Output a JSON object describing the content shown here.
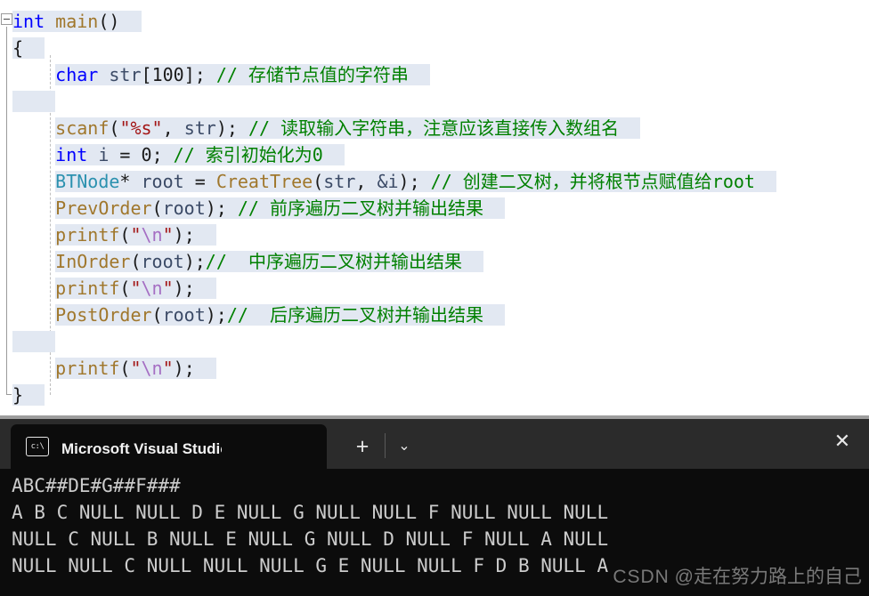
{
  "editor": {
    "collapse_state": "expanded",
    "colors": {
      "selection_bg": "#e2e8f2",
      "keyword": "#0000ff",
      "user_type": "#2b91af",
      "function": "#a0772c",
      "identifier": "#3b4a66",
      "string": "#a31515",
      "escape": "#a56ec3",
      "comment": "#008000",
      "background": "#ffffff"
    },
    "lines": [
      {
        "indent": 0,
        "tokens": [
          {
            "t": "int",
            "c": "kw"
          },
          {
            "t": " ",
            "c": "pun"
          },
          {
            "t": "main",
            "c": "fn"
          },
          {
            "t": "()",
            "c": "pun"
          }
        ]
      },
      {
        "indent": 0,
        "tokens": [
          {
            "t": "{",
            "c": "brace"
          }
        ]
      },
      {
        "indent": 1,
        "tokens": [
          {
            "t": "char",
            "c": "kw"
          },
          {
            "t": " ",
            "c": "pun"
          },
          {
            "t": "str",
            "c": "id"
          },
          {
            "t": "[",
            "c": "pun"
          },
          {
            "t": "100",
            "c": "num"
          },
          {
            "t": "]; ",
            "c": "pun"
          },
          {
            "t": "// 存储节点值的字符串",
            "c": "cm"
          }
        ]
      },
      {
        "indent": 0,
        "tokens": []
      },
      {
        "indent": 1,
        "tokens": [
          {
            "t": "scanf",
            "c": "fn"
          },
          {
            "t": "(",
            "c": "pun"
          },
          {
            "t": "\"%s\"",
            "c": "str"
          },
          {
            "t": ", ",
            "c": "pun"
          },
          {
            "t": "str",
            "c": "id"
          },
          {
            "t": "); ",
            "c": "pun"
          },
          {
            "t": "// 读取输入字符串，注意应该直接传入数组名",
            "c": "cm"
          }
        ]
      },
      {
        "indent": 1,
        "tokens": [
          {
            "t": "int",
            "c": "kw"
          },
          {
            "t": " ",
            "c": "pun"
          },
          {
            "t": "i",
            "c": "id"
          },
          {
            "t": " = ",
            "c": "pun"
          },
          {
            "t": "0",
            "c": "num"
          },
          {
            "t": "; ",
            "c": "pun"
          },
          {
            "t": "// 索引初始化为0",
            "c": "cm"
          }
        ]
      },
      {
        "indent": 1,
        "tokens": [
          {
            "t": "BTNode",
            "c": "type"
          },
          {
            "t": "* ",
            "c": "pun"
          },
          {
            "t": "root",
            "c": "id"
          },
          {
            "t": " = ",
            "c": "pun"
          },
          {
            "t": "CreatTree",
            "c": "fn"
          },
          {
            "t": "(",
            "c": "pun"
          },
          {
            "t": "str",
            "c": "id"
          },
          {
            "t": ", ",
            "c": "pun"
          },
          {
            "t": "&i",
            "c": "id"
          },
          {
            "t": "); ",
            "c": "pun"
          },
          {
            "t": "// 创建二叉树，并将根节点赋值给root",
            "c": "cm"
          }
        ]
      },
      {
        "indent": 1,
        "tokens": [
          {
            "t": "PrevOrder",
            "c": "fn"
          },
          {
            "t": "(",
            "c": "pun"
          },
          {
            "t": "root",
            "c": "id"
          },
          {
            "t": "); ",
            "c": "pun"
          },
          {
            "t": "// 前序遍历二叉树并输出结果",
            "c": "cm"
          }
        ]
      },
      {
        "indent": 1,
        "tokens": [
          {
            "t": "printf",
            "c": "fn"
          },
          {
            "t": "(",
            "c": "pun"
          },
          {
            "t": "\"",
            "c": "str"
          },
          {
            "t": "\\n",
            "c": "esc"
          },
          {
            "t": "\"",
            "c": "str"
          },
          {
            "t": ");",
            "c": "pun"
          }
        ]
      },
      {
        "indent": 1,
        "tokens": [
          {
            "t": "InOrder",
            "c": "fn"
          },
          {
            "t": "(",
            "c": "pun"
          },
          {
            "t": "root",
            "c": "id"
          },
          {
            "t": ");",
            "c": "pun"
          },
          {
            "t": "//  中序遍历二叉树并输出结果",
            "c": "cm"
          }
        ]
      },
      {
        "indent": 1,
        "tokens": [
          {
            "t": "printf",
            "c": "fn"
          },
          {
            "t": "(",
            "c": "pun"
          },
          {
            "t": "\"",
            "c": "str"
          },
          {
            "t": "\\n",
            "c": "esc"
          },
          {
            "t": "\"",
            "c": "str"
          },
          {
            "t": ");",
            "c": "pun"
          }
        ]
      },
      {
        "indent": 1,
        "tokens": [
          {
            "t": "PostOrder",
            "c": "fn"
          },
          {
            "t": "(",
            "c": "pun"
          },
          {
            "t": "root",
            "c": "id"
          },
          {
            "t": ");",
            "c": "pun"
          },
          {
            "t": "//  后序遍历二叉树并输出结果",
            "c": "cm"
          }
        ]
      },
      {
        "indent": 0,
        "tokens": []
      },
      {
        "indent": 1,
        "tokens": [
          {
            "t": "printf",
            "c": "fn"
          },
          {
            "t": "(",
            "c": "pun"
          },
          {
            "t": "\"",
            "c": "str"
          },
          {
            "t": "\\n",
            "c": "esc"
          },
          {
            "t": "\"",
            "c": "str"
          },
          {
            "t": ");",
            "c": "pun"
          }
        ]
      },
      {
        "indent": 0,
        "tokens": [
          {
            "t": "}",
            "c": "brace"
          }
        ]
      }
    ]
  },
  "terminal": {
    "tab": {
      "icon": "console-icon",
      "icon_label": "c:\\",
      "title": "Microsoft Visual Studio 调试控",
      "close_label": "✕"
    },
    "new_tab_label": "+",
    "dropdown_label": "⌄",
    "output": [
      "ABC##DE#G##F###",
      "A B C NULL NULL D E NULL G NULL NULL F NULL NULL NULL",
      "NULL C NULL B NULL E NULL G NULL D NULL F NULL A NULL",
      "NULL NULL C NULL NULL NULL G E NULL NULL F D B NULL A"
    ]
  },
  "watermark": {
    "brand": "CSDN",
    "author": "@走在努力路上的自己"
  }
}
